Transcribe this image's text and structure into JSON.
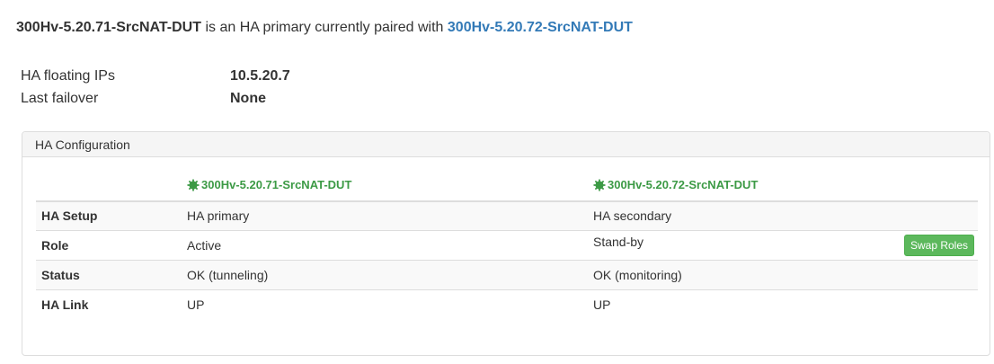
{
  "summary": {
    "primary_name": "300Hv-5.20.71-SrcNAT-DUT",
    "middle_text": " is an HA primary currently paired with ",
    "peer_link": "300Hv-5.20.72-SrcNAT-DUT"
  },
  "info": {
    "floating_ips_label": "HA floating IPs",
    "floating_ips_value": "10.5.20.7",
    "last_failover_label": "Last failover",
    "last_failover_value": "None"
  },
  "panel": {
    "title": "HA Configuration",
    "device_primary": "300Hv-5.20.71-SrcNAT-DUT",
    "device_secondary": "300Hv-5.20.72-SrcNAT-DUT",
    "status_color": "#3c9a45",
    "swap_button": "Swap Roles",
    "rows": [
      {
        "label": "HA Setup",
        "primary": "HA primary",
        "secondary": "HA secondary"
      },
      {
        "label": "Role",
        "primary": "Active",
        "secondary": "Stand-by"
      },
      {
        "label": "Status",
        "primary": "OK (tunneling)",
        "secondary": "OK (monitoring)"
      },
      {
        "label": "HA Link",
        "primary": "UP",
        "secondary": "UP"
      }
    ]
  }
}
